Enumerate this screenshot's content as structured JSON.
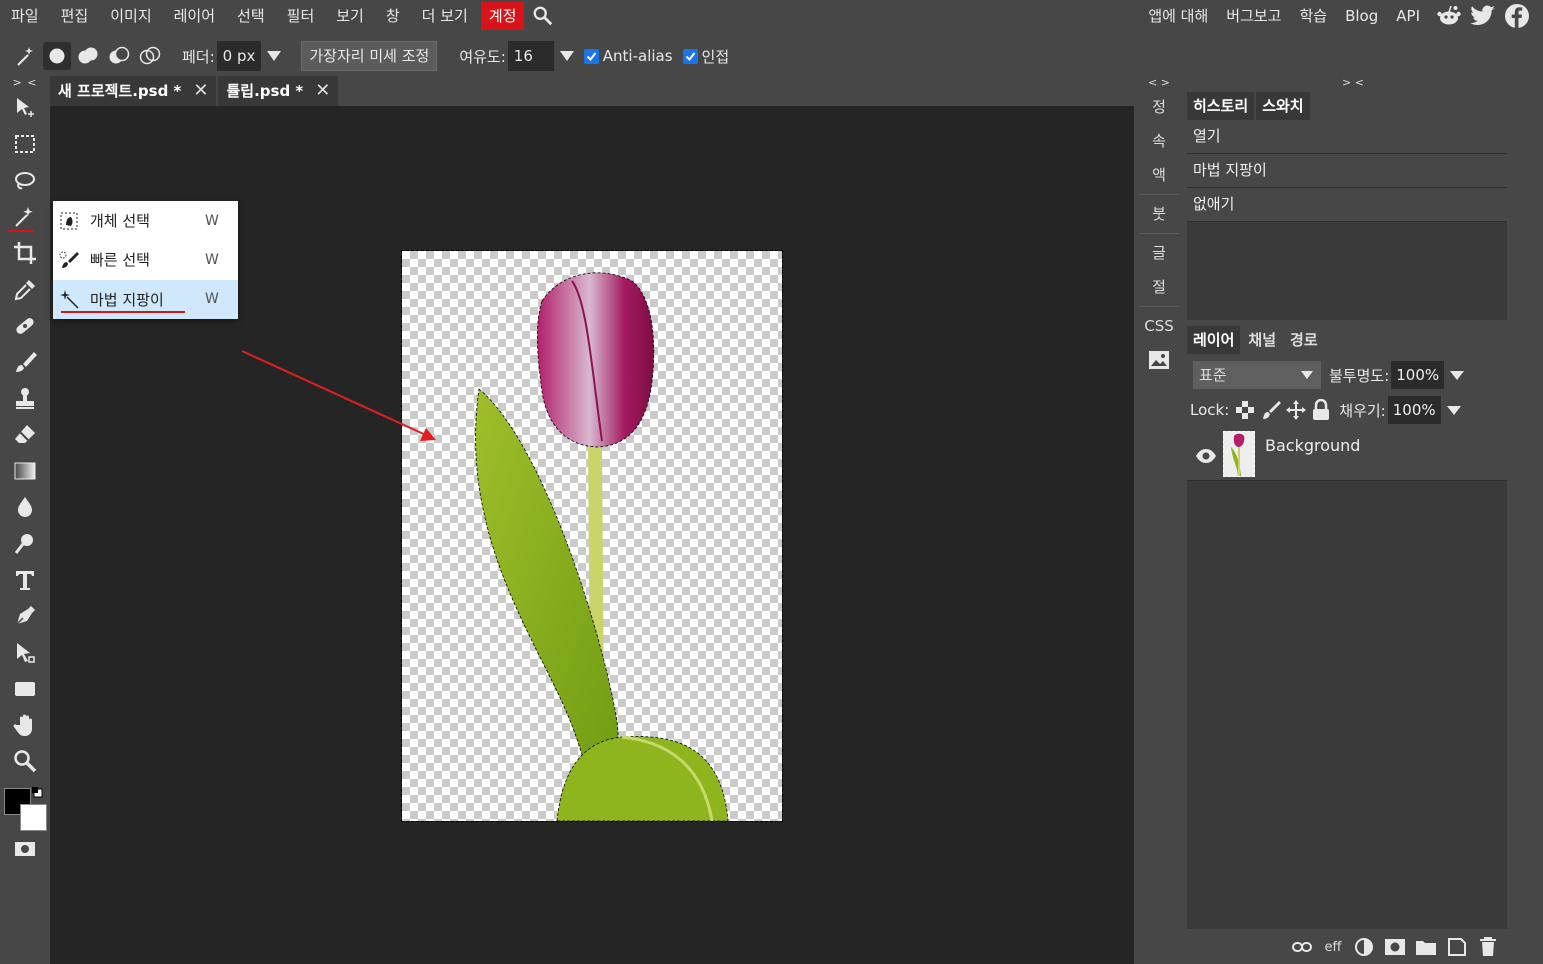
{
  "menubar": {
    "items": [
      "파일",
      "편집",
      "이미지",
      "레이어",
      "선택",
      "필터",
      "보기",
      "창",
      "더 보기"
    ],
    "account": "계정",
    "right_items": [
      "앱에 대해",
      "버그보고",
      "학습",
      "Blog",
      "API"
    ]
  },
  "options": {
    "feather_label": "페더:",
    "feather_value": "0 px",
    "refine_edge": "가장자리 미세 조정",
    "tolerance_label": "여유도:",
    "tolerance_value": "16",
    "antialias_label": "Anti-alias",
    "contiguous_label": "인접"
  },
  "toolbar": {
    "collapse": "> <"
  },
  "tabs": [
    {
      "label": "새 프로젝트.psd *"
    },
    {
      "label": "튤립.psd *"
    }
  ],
  "flyout": {
    "items": [
      {
        "label": "개체 선택",
        "key": "W"
      },
      {
        "label": "빠른 선택",
        "key": "W"
      },
      {
        "label": "마법 지팡이",
        "key": "W"
      }
    ]
  },
  "sidestrip": {
    "collapse": "< >",
    "items": [
      "정",
      "속",
      "액",
      "붓",
      "글",
      "절",
      "CSS"
    ]
  },
  "panels": {
    "collapse": "> <",
    "history_tabs": [
      "히스토리",
      "스와치"
    ],
    "history": [
      "열기",
      "마법 지팡이",
      "없애기"
    ],
    "layer_tabs": [
      "레이어",
      "채널",
      "경로"
    ],
    "blend_mode": "표준",
    "opacity_label": "불투명도:",
    "opacity_value": "100%",
    "lock_label": "Lock:",
    "fill_label": "채우기:",
    "fill_value": "100%",
    "layers": [
      {
        "name": "Background"
      }
    ],
    "footer_eff": "eff"
  },
  "colors": {
    "accent": "#d8141a",
    "selection": "#cfe8fb",
    "checkbox": "#1a73e8"
  }
}
